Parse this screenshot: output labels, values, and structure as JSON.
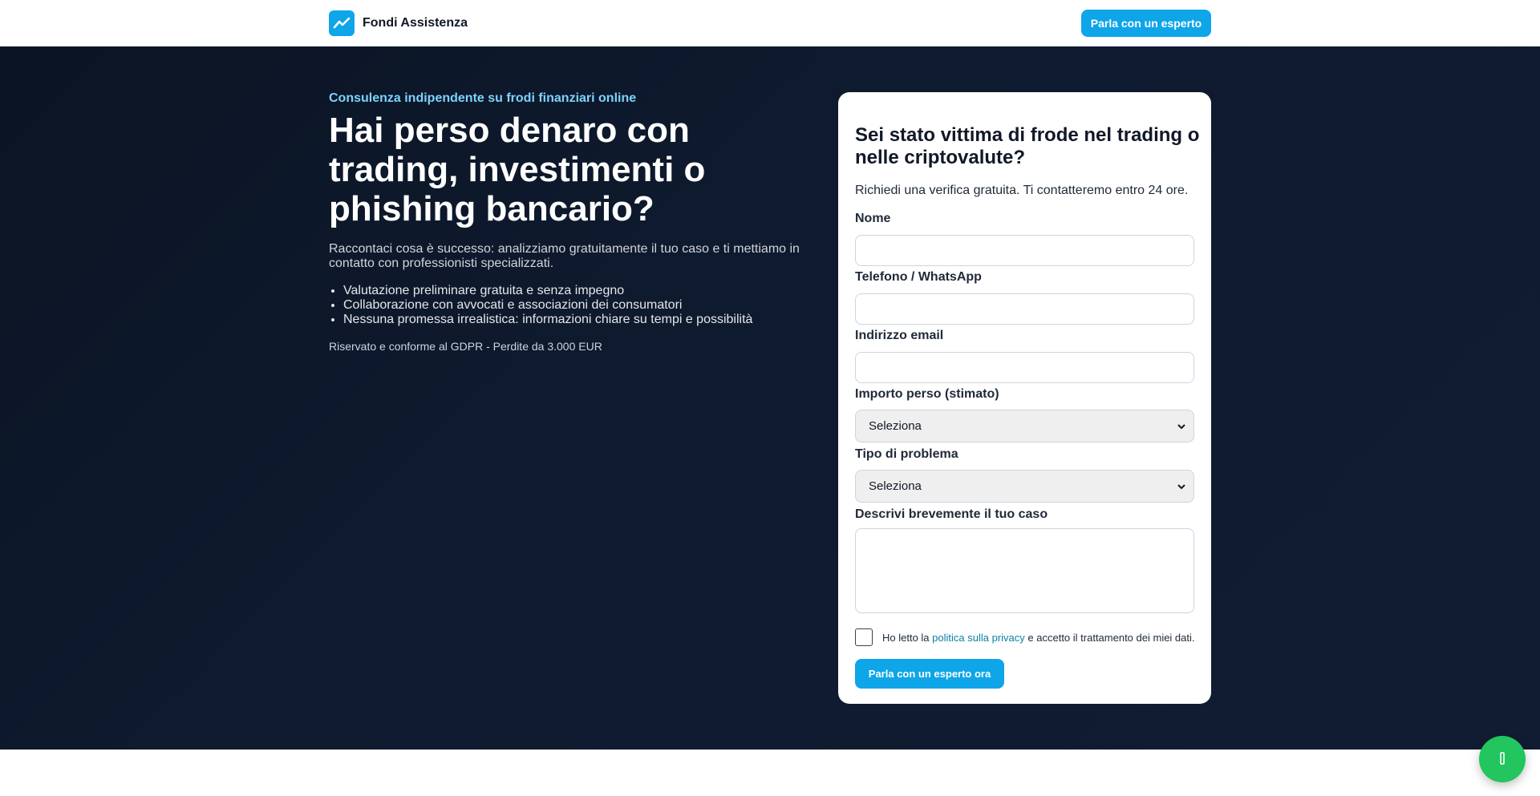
{
  "header": {
    "brand_name": "Fondi Assistenza",
    "cta_label": "Parla con un esperto",
    "logo_icon": "chart-line-icon"
  },
  "hero": {
    "eyebrow": "Consulenza indipendente su frodi finanziari online",
    "title": "Hai perso denaro con trading, investimenti o phishing bancario?",
    "subtitle": "Raccontaci cosa è successo: analizziamo gratuitamente il tuo caso e ti mettiamo in contatto con professionisti specializzati.",
    "bullets": [
      "Valutazione preliminare gratuita e senza impegno",
      "Collaborazione con avvocati e associazioni dei consumatori",
      "Nessuna promessa irrealistica: informazioni chiare su tempi e possibilità"
    ],
    "note": "Riservato e conforme al GDPR - Perdite da 3.000 EUR"
  },
  "form": {
    "title": "Sei stato vittima di frode nel trading o nelle criptovalute?",
    "subtitle": "Richiedi una verifica gratuita. Ti contatteremo entro 24 ore.",
    "name_label": "Nome",
    "name_value": "",
    "phone_label": "Telefono / WhatsApp",
    "phone_value": "",
    "email_label": "Indirizzo email",
    "email_value": "",
    "amount_label": "Importo perso (stimato)",
    "amount_selected": "Seleziona",
    "problem_label": "Tipo di problema",
    "problem_selected": "Seleziona",
    "description_label": "Descrivi brevemente il tuo caso",
    "description_value": "",
    "consent_prefix": "Ho letto la",
    "consent_link": "politica sulla privacy",
    "consent_suffix": "e accetto il trattamento dei miei dati.",
    "consent_checked": false,
    "submit_label": "Parla con un esperto ora"
  },
  "fab": {
    "icon": "chat-icon"
  },
  "colors": {
    "accent": "#0ea5e9",
    "hero_bg": "#0e1a2e",
    "eyebrow": "#7dd3fc",
    "fab": "#22c55e"
  }
}
